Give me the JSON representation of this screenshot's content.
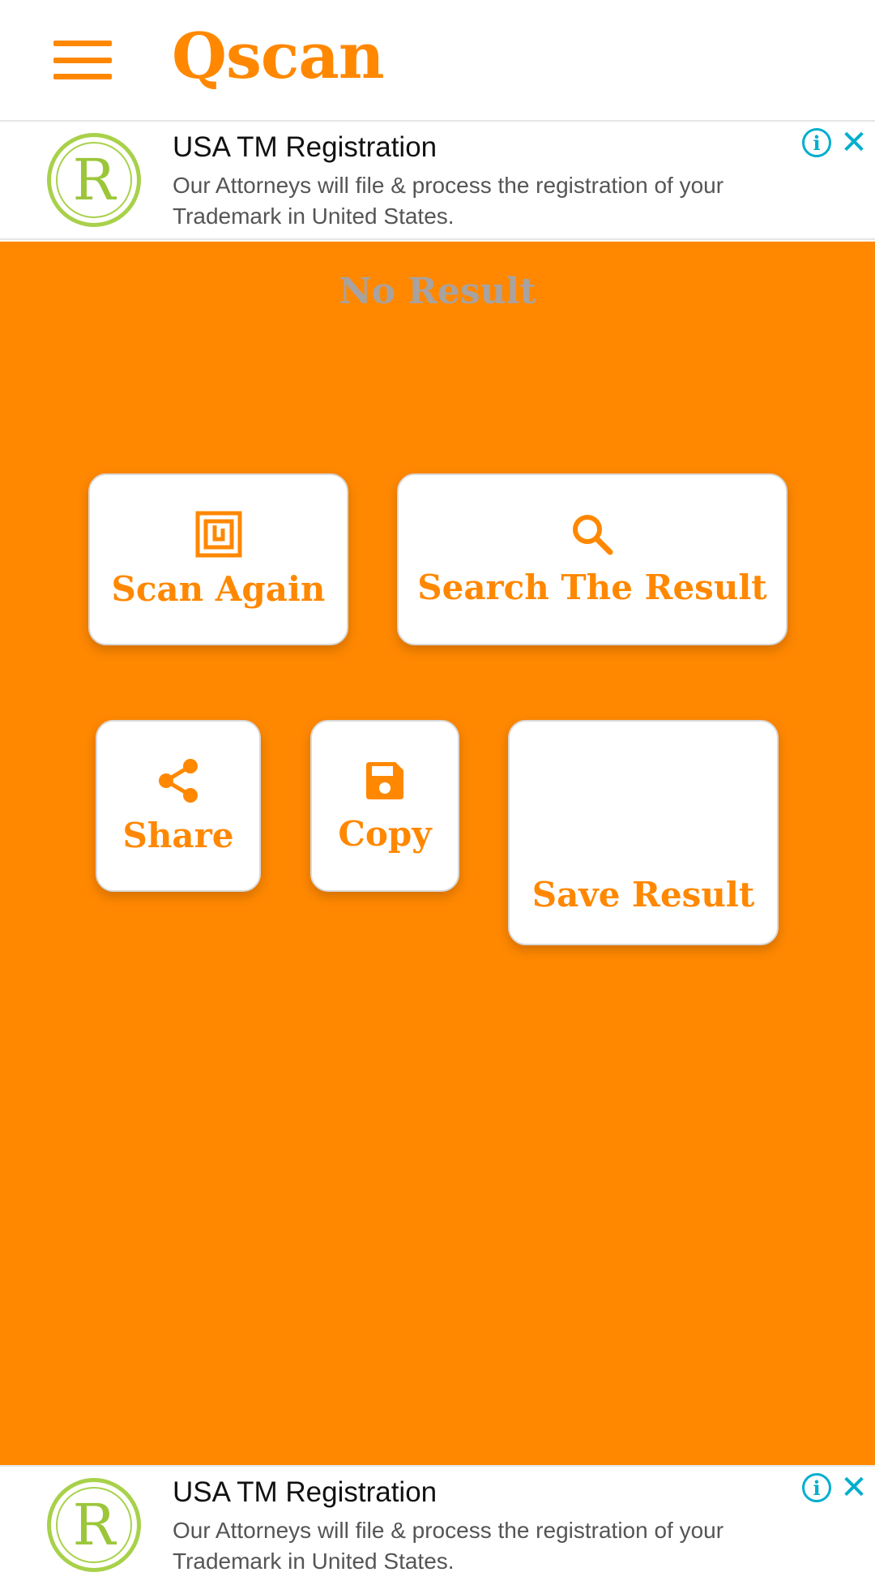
{
  "app": {
    "title": "Qscan",
    "accent_color": "#ff8800",
    "menu_icon": "hamburger-menu-icon"
  },
  "ads": {
    "top": {
      "logo_letter": "R",
      "title": "USA TM Registration",
      "body": "Our Attorneys will file & process the registration of your Trademark in United States.",
      "info_icon": "ⓘ",
      "close_icon": "✕"
    },
    "bottom": {
      "logo_letter": "R",
      "title": "USA TM Registration",
      "body": "Our Attorneys will file & process the registration of your Trademark in United States.",
      "info_icon": "ⓘ",
      "close_icon": "✕"
    }
  },
  "main": {
    "result_text": "No Result",
    "buttons": {
      "scan_again": "Scan Again",
      "search_result": "Search The Result",
      "share": "Share",
      "copy": "Copy",
      "save_result": "Save Result"
    }
  }
}
